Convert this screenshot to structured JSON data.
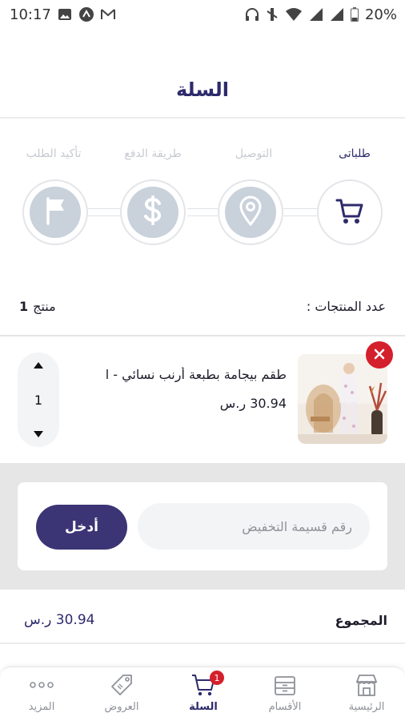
{
  "status_bar": {
    "time": "10:17",
    "battery": "20%"
  },
  "header": {
    "title": "السلة"
  },
  "stepper": {
    "steps": [
      {
        "label": "طلباتى",
        "icon": "cart-icon",
        "active": true
      },
      {
        "label": "التوصيل",
        "icon": "location-pin-icon",
        "active": false
      },
      {
        "label": "طريقة الدفع",
        "icon": "dollar-icon",
        "active": false
      },
      {
        "label": "تأكيد الطلب",
        "icon": "flag-icon",
        "active": false
      }
    ]
  },
  "summary": {
    "count_label": "عدد المنتجات :",
    "count_value": "1",
    "count_unit": "منتج"
  },
  "cart_item": {
    "name": "طقم بيجامة بطبعة أرنب نسائي - ا",
    "price": "30.94 ر.س",
    "quantity": "1"
  },
  "coupon": {
    "placeholder": "رقم قسيمة التخفيض",
    "submit_label": "أدخل"
  },
  "total": {
    "label": "المجموع",
    "value": "30.94 ر.س"
  },
  "bottom_nav": {
    "items": [
      {
        "label": "الرئيسية",
        "icon": "store-icon"
      },
      {
        "label": "الأقسام",
        "icon": "categories-icon"
      },
      {
        "label": "السلة",
        "icon": "cart-icon",
        "badge": "1",
        "active": true
      },
      {
        "label": "العروض",
        "icon": "tag-icon"
      },
      {
        "label": "المزيد",
        "icon": "more-dots-icon"
      }
    ]
  },
  "colors": {
    "primary": "#2d2b6b",
    "button": "#3b3575",
    "danger": "#d4202c",
    "inactive": "#c9d1db"
  }
}
